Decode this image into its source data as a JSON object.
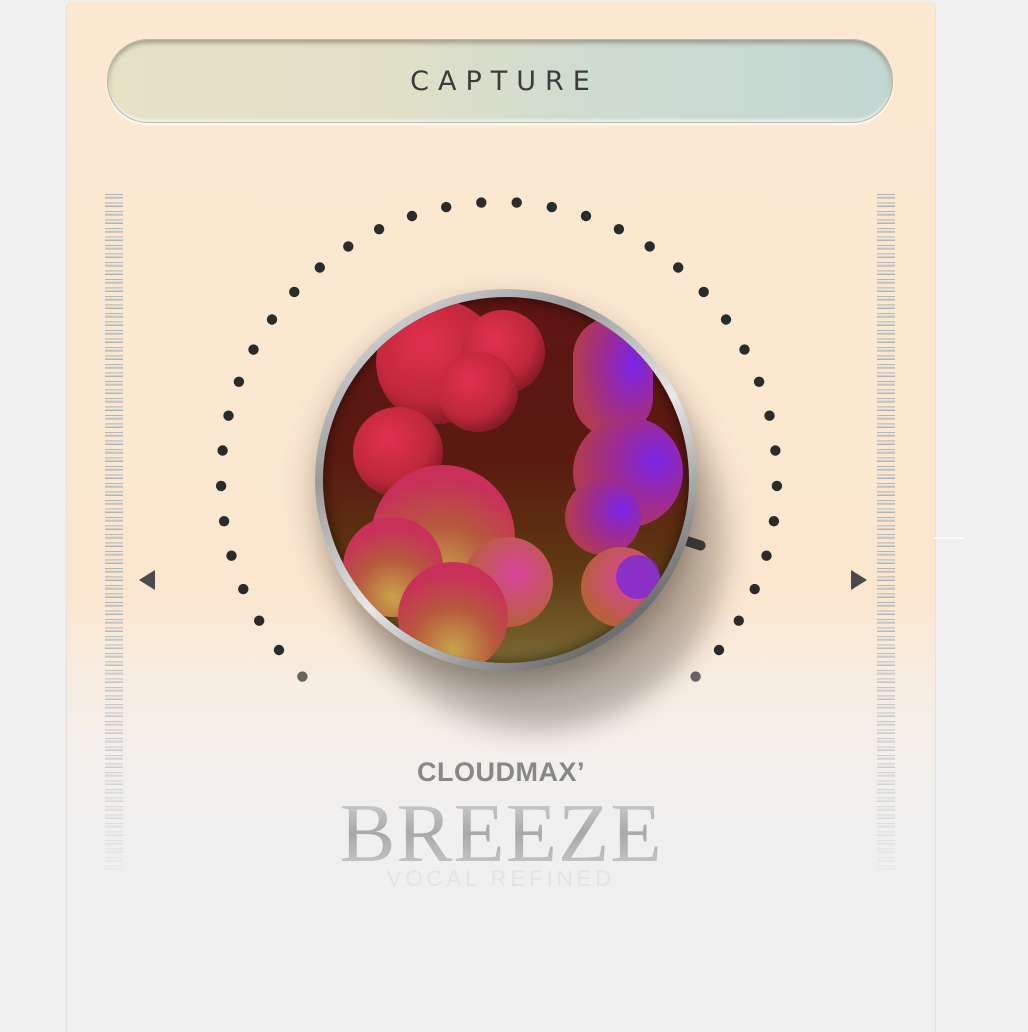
{
  "capture_button": {
    "label": "CAPTURE"
  },
  "knob": {
    "value": 0.9,
    "indicator_icon": "knob-indicator"
  },
  "navigation": {
    "prev_icon": "triangle-left-icon",
    "next_icon": "triangle-right-icon"
  },
  "branding": {
    "company": "CLOUDMAX’",
    "product": "BREEZE",
    "tagline": "VOCAL REFINED"
  },
  "colors": {
    "panel": "#fbe8d1",
    "background": "#f0f0f0",
    "button_left": "#e5e2c6",
    "button_right": "#c3d7d2",
    "label_text": "#3b3b3b",
    "dot": "#2b2b2b"
  }
}
